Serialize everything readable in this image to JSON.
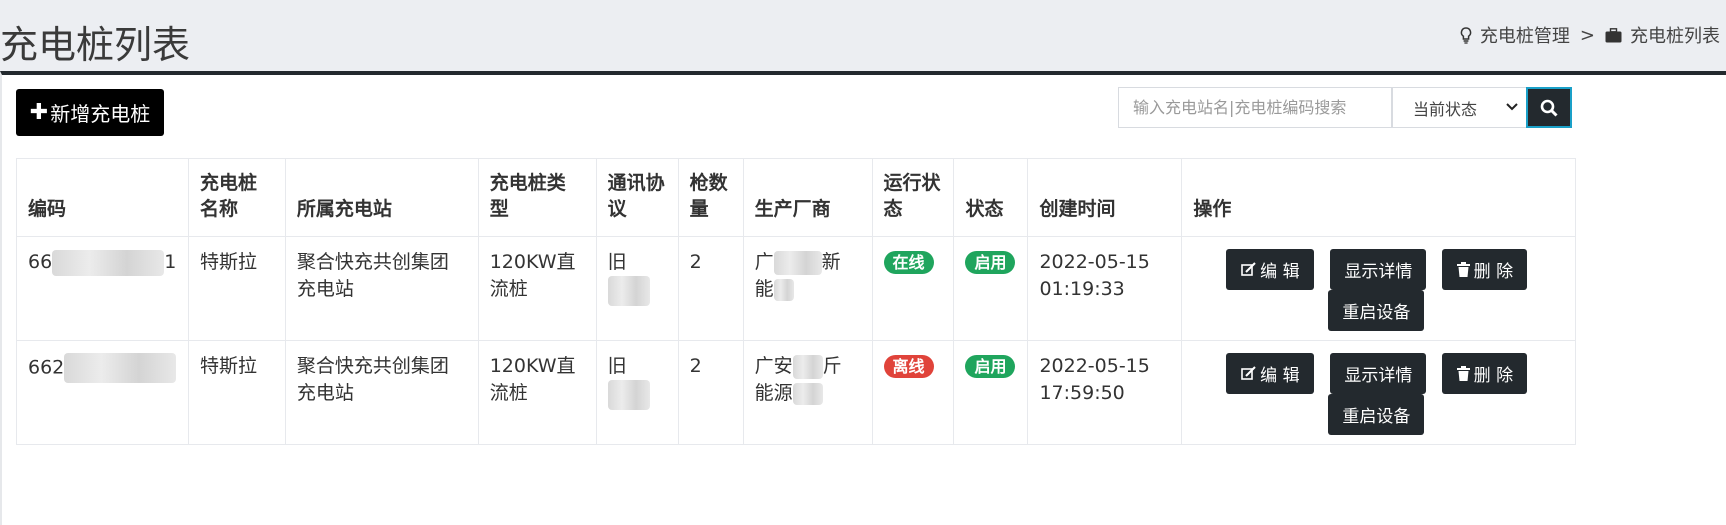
{
  "header": {
    "title": "充电桩列表",
    "breadcrumb": [
      {
        "icon": "lightbulb-icon",
        "label": "充电桩管理"
      },
      {
        "icon": "briefcase-icon",
        "label": "充电桩列表"
      }
    ],
    "separator": ">"
  },
  "toolbar": {
    "add_label": "新增充电桩",
    "search_placeholder": "输入充电站名|充电桩编码搜索",
    "status_select": "当前状态",
    "search_icon": "search-icon"
  },
  "table": {
    "columns": [
      "编码",
      "充电桩名称",
      "所属充电站",
      "充电桩类型",
      "通讯协议",
      "枪数量",
      "生产厂商",
      "运行状态",
      "状态",
      "创建时间",
      "操作"
    ],
    "rows": [
      {
        "code_prefix": "66",
        "code_suffix": "1",
        "name": "特斯拉",
        "station": "聚合快充共创集团充电站",
        "type": "120KW直流桩",
        "protocol_prefix": "旧",
        "guns": "2",
        "maker_a": "广",
        "maker_b": "新",
        "maker_c": "能",
        "run_status": "在线",
        "run_color": "#1fa55d",
        "status": "启用",
        "created": "2022-05-15 01:19:33"
      },
      {
        "code_prefix": "662",
        "code_suffix": "",
        "name": "特斯拉",
        "station": "聚合快充共创集团充电站",
        "type": "120KW直流桩",
        "protocol_prefix": "旧",
        "guns": "2",
        "maker_a": "广安",
        "maker_b": "斤",
        "maker_c": "能源",
        "run_status": "离线",
        "run_color": "#e0433a",
        "status": "启用",
        "created": "2022-05-15 17:59:50"
      }
    ],
    "actions": {
      "edit": "编 辑",
      "details": "显示详情",
      "delete": "删 除",
      "restart": "重启设备"
    }
  }
}
